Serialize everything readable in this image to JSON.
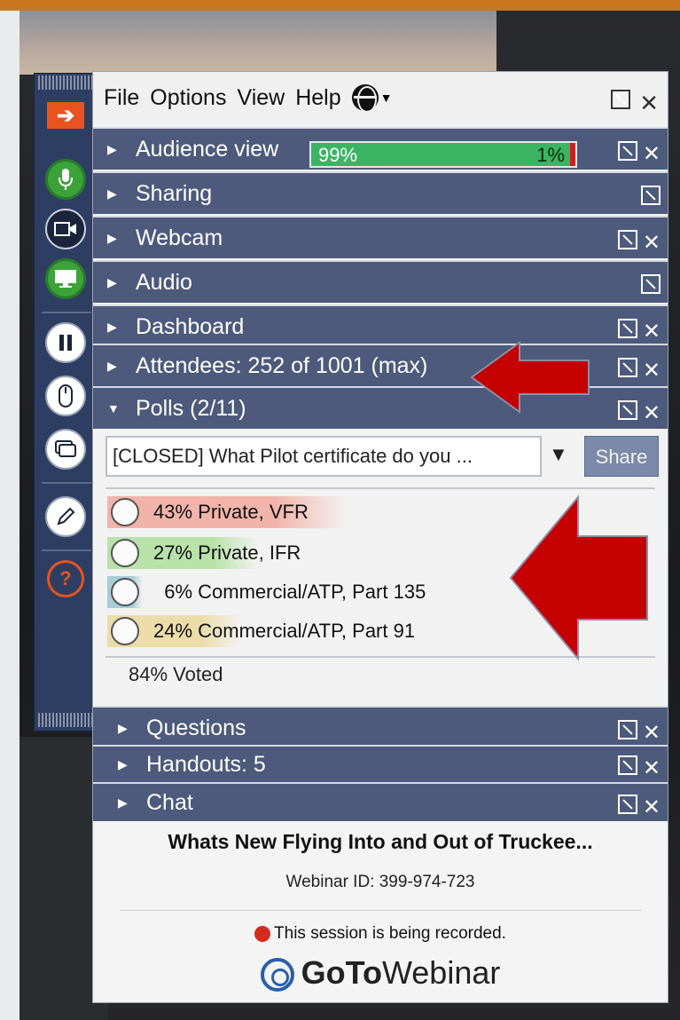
{
  "menubar": {
    "items": [
      "File",
      "Options",
      "View",
      "Help"
    ]
  },
  "sections": {
    "audience": {
      "label": "Audience view",
      "meter_left": "99%",
      "meter_right": "1%",
      "meter_level": 0.99
    },
    "sharing": {
      "label": "Sharing"
    },
    "webcam": {
      "label": "Webcam"
    },
    "audio": {
      "label": "Audio"
    },
    "dashboard": {
      "label": "Dashboard"
    },
    "attendees": {
      "label": "Attendees:  252 of 1001 (max)"
    },
    "polls": {
      "label": "Polls (2/11)"
    },
    "questions": {
      "label": "Questions"
    },
    "handouts": {
      "label": "Handouts: 5"
    },
    "chat": {
      "label": "Chat"
    }
  },
  "poll": {
    "question": "[CLOSED] What Pilot certificate do you ...",
    "share_label": "Share",
    "options": [
      {
        "text": "43% Private, VFR",
        "percent": 43,
        "color": "#f2b4aa"
      },
      {
        "text": "27% Private, IFR",
        "percent": 27,
        "color": "#b8e2a8"
      },
      {
        "text": "  6% Commercial/ATP, Part 135",
        "percent": 6,
        "color": "#a8ccd8"
      },
      {
        "text": "24% Commercial/ATP, Part 91",
        "percent": 24,
        "color": "#ecdca8"
      }
    ],
    "voted": "84% Voted"
  },
  "footer": {
    "webinar_title": "Whats New Flying Into and Out of Truckee...",
    "webinar_id": "Webinar ID: 399-974-723",
    "recording": "This session is being recorded.",
    "brand_bold": "GoTo",
    "brand_light": "Webinar"
  },
  "colors": {
    "section_header": "#4d5a7c",
    "toolbar": "#2e3e63",
    "annotation_arrow": "#c40000",
    "mic_active": "#3ba33a"
  },
  "icons": [
    "arrow-right-icon",
    "microphone-icon",
    "webcam-icon",
    "screen-share-icon",
    "pause-icon",
    "mouse-icon",
    "view-icon",
    "pen-icon",
    "help-icon",
    "globe-icon",
    "undock-icon",
    "close-icon",
    "triangle-right-icon",
    "triangle-down-icon",
    "chevron-down-icon",
    "gotowebinar-logo-icon"
  ]
}
